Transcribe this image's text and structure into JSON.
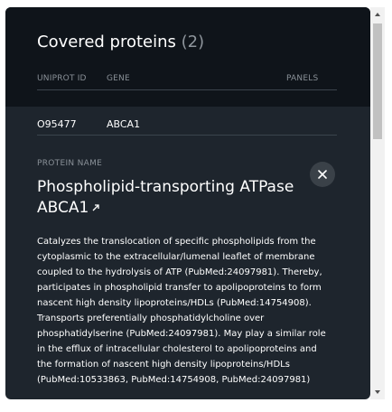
{
  "panel": {
    "title": "Covered proteins",
    "count": "(2)"
  },
  "table": {
    "columns": [
      "UNIPROT ID",
      "GENE",
      "PANELS"
    ],
    "rows": [
      {
        "uniprot_id": "O95477",
        "gene": "ABCA1",
        "panels": ""
      }
    ]
  },
  "detail": {
    "section_label": "PROTEIN NAME",
    "protein_name": "Phospholipid-transporting ATPase ABCA1",
    "description": "Catalyzes the translocation of specific phospholipids from the cytoplasmic to the extracellular/lumenal leaflet of membrane coupled to the hydrolysis of ATP (PubMed:24097981). Thereby, participates in phospholipid transfer to apolipoproteins to form nascent high density lipoproteins/HDLs (PubMed:14754908). Transports preferentially phosphatidylcholine over phosphatidylserine (PubMed:24097981). May play a similar role in the efflux of intracellular cholesterol to apolipoproteins and the formation of nascent high density lipoproteins/HDLs (PubMed:10533863, PubMed:14754908, PubMed:24097981)",
    "close_icon": "close-icon",
    "external_link_icon": "external-link-icon"
  },
  "colors": {
    "panel_bg": "#1e252d",
    "header_bg": "#0f141a",
    "muted_text": "#8a9198",
    "text": "#ffffff"
  }
}
